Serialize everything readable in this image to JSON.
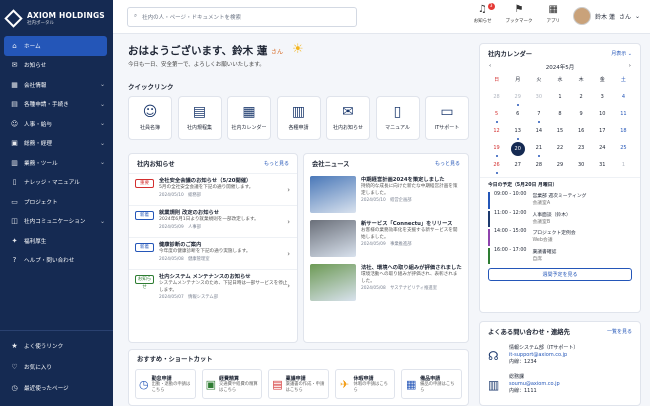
{
  "brand": {
    "name": "AXIOM HOLDINGS",
    "sub": "社内ポータル"
  },
  "sidebar": {
    "items": [
      {
        "label": "ホーム",
        "icon": "home-icon",
        "glyph": "⌂",
        "active": true
      },
      {
        "label": "お知らせ",
        "icon": "megaphone-icon",
        "glyph": "✉"
      },
      {
        "label": "会社情報",
        "icon": "building-icon",
        "glyph": "▦",
        "chev": true
      },
      {
        "label": "各種申請・手続き",
        "icon": "document-icon",
        "glyph": "▤",
        "chev": true
      },
      {
        "label": "人事・給与",
        "icon": "person-icon",
        "glyph": "☺",
        "chev": true
      },
      {
        "label": "総務・経理",
        "icon": "calculator-icon",
        "glyph": "▣",
        "chev": true
      },
      {
        "label": "業務・ツール",
        "icon": "briefcase-icon",
        "glyph": "▥",
        "chev": true
      },
      {
        "label": "ナレッジ・マニュアル",
        "icon": "book-icon",
        "glyph": "▯"
      },
      {
        "label": "プロジェクト",
        "icon": "folder-icon",
        "glyph": "▭"
      },
      {
        "label": "社内コミュニケーション",
        "icon": "chat-icon",
        "glyph": "◫",
        "chev": true
      },
      {
        "label": "福利厚生",
        "icon": "gift-icon",
        "glyph": "✦"
      },
      {
        "label": "ヘルプ・問い合わせ",
        "icon": "help-icon",
        "glyph": "?"
      }
    ],
    "bottom": [
      {
        "label": "よく使うリンク",
        "icon": "star-icon",
        "glyph": "★"
      },
      {
        "label": "お気に入り",
        "icon": "heart-icon",
        "glyph": "♡"
      },
      {
        "label": "最近使ったページ",
        "icon": "clock-icon",
        "glyph": "◷"
      }
    ]
  },
  "search": {
    "placeholder": "社内の人・ページ・ドキュメントを検索"
  },
  "topbar": {
    "notify": "お知らせ",
    "notify_count": "3",
    "bookmark": "ブックマーク",
    "apps": "アプリ",
    "user": "鈴木 蓮",
    "honorific": "さん"
  },
  "greeting": {
    "text": "おはようございます、鈴木 蓮",
    "suffix": "さん",
    "sub": "今日も一日、安全第一で、よろしくお願いいたします。"
  },
  "quick": {
    "title": "クイックリンク",
    "items": [
      {
        "label": "社員名簿",
        "glyph": "☺",
        "icon": "people-icon"
      },
      {
        "label": "社内規程集",
        "glyph": "▤",
        "icon": "document-icon"
      },
      {
        "label": "社内カレンダー",
        "glyph": "▦",
        "icon": "calendar-icon"
      },
      {
        "label": "各種申請",
        "glyph": "▥",
        "icon": "form-icon"
      },
      {
        "label": "社内お知らせ",
        "glyph": "✉",
        "icon": "megaphone-icon"
      },
      {
        "label": "マニュアル",
        "glyph": "▯",
        "icon": "book-icon"
      },
      {
        "label": "ITサポート",
        "glyph": "▭",
        "icon": "monitor-icon"
      }
    ]
  },
  "notices": {
    "title": "社内お知らせ",
    "more": "もっと見る",
    "items": [
      {
        "tag": "重要",
        "color": "#d32f2f",
        "title": "全社安全会議のお知らせ（5/20開催）",
        "desc": "5月の全社安全会議を下記の通り開催します。",
        "date": "2024/05/10",
        "dept": "総務部"
      },
      {
        "tag": "新着",
        "color": "#2456b8",
        "title": "就業規則 改定のお知らせ",
        "desc": "2024年6月1日より就業規則を一部改定します。",
        "date": "2024/05/09",
        "dept": "人事部"
      },
      {
        "tag": "新着",
        "color": "#2456b8",
        "title": "健康診断のご案内",
        "desc": "今年度の健康診断を下記の通り実施します。",
        "date": "2024/05/08",
        "dept": "健康管理室"
      },
      {
        "tag": "お知らせ",
        "color": "#2e7d32",
        "title": "社内システム メンテナンスのお知らせ",
        "desc": "システムメンテナンスのため、下記日時は一部サービスを停止します。",
        "date": "2024/05/07",
        "dept": "情報システム部"
      }
    ]
  },
  "news": {
    "title": "会社ニュース",
    "more": "もっと見る",
    "items": [
      {
        "title": "中期経営計画2024を策定しました",
        "desc": "持続的な成長に向けた新たな中期経営計画を策定しました。",
        "date": "2024/05/10",
        "dept": "経営企画部",
        "color": "#4a78b8"
      },
      {
        "title": "新サービス「Connectu」をリリース",
        "desc": "お客様の業務効率化を支援する新サービスを開始しました。",
        "date": "2024/05/09",
        "dept": "事業推進部",
        "color": "#6a6f79"
      },
      {
        "title": "法社、環境への取り組みが評価されました",
        "desc": "環境活動への取り組みが評価され、表彰されました。",
        "date": "2024/05/08",
        "dept": "サステナビリティ推進室",
        "color": "#6d9a55"
      }
    ]
  },
  "calendar": {
    "title": "社内カレンダー",
    "view": "月表示",
    "month": "2024年5月",
    "weekdays": [
      "日",
      "月",
      "火",
      "水",
      "木",
      "金",
      "土"
    ],
    "days": [
      "28",
      "29",
      "30",
      "1",
      "2",
      "3",
      "4",
      "5",
      "6",
      "7",
      "8",
      "9",
      "10",
      "11",
      "12",
      "13",
      "14",
      "15",
      "16",
      "17",
      "18",
      "19",
      "20",
      "21",
      "22",
      "23",
      "24",
      "25",
      "26",
      "27",
      "28",
      "29",
      "30",
      "31",
      "1"
    ],
    "today": "20"
  },
  "schedule": {
    "title": "今日の予定（5月20日 月曜日）",
    "items": [
      {
        "time": "09:00 - 10:00",
        "title": "営業部 週次ミーティング",
        "place": "会議室A",
        "color": "#2456b8"
      },
      {
        "time": "11:00 - 12:00",
        "title": "人事面談（鈴木）",
        "place": "会議室B",
        "color": "#1d3a6e"
      },
      {
        "time": "14:00 - 15:00",
        "title": "プロジェクト定例会",
        "place": "Web会議",
        "color": "#8e44ad"
      },
      {
        "time": "16:00 - 17:00",
        "title": "稟議書確認",
        "place": "自席",
        "color": "#2e7d32"
      }
    ],
    "button": "週間予定を見る"
  },
  "shortcuts": {
    "title": "おすすめ・ショートカット",
    "items": [
      {
        "title": "勤怠申請",
        "desc": "出勤・退勤の申請はこちら",
        "glyph": "◷",
        "icon": "clock-icon",
        "color": "#2456b8"
      },
      {
        "title": "経費精算",
        "desc": "交通費や経費の精算はこちら",
        "glyph": "▣",
        "icon": "receipt-icon",
        "color": "#2e7d32"
      },
      {
        "title": "稟議申請",
        "desc": "稟議書の作成・申請はこちら",
        "glyph": "▤",
        "icon": "approval-icon",
        "color": "#d32f2f"
      },
      {
        "title": "休暇申請",
        "desc": "休暇の申請はこちら",
        "glyph": "✈",
        "icon": "plane-icon",
        "color": "#f39c12"
      },
      {
        "title": "備品申請",
        "desc": "備品の申請はこちら",
        "glyph": "▦",
        "icon": "box-icon",
        "color": "#2456b8"
      }
    ]
  },
  "contacts": {
    "title": "よくある問い合わせ・連絡先",
    "more": "一覧を見る",
    "items": [
      {
        "dept": "情報システム部（ITサポート）",
        "mail": "it-support@axiom.co.jp",
        "tel": "内線：1234",
        "glyph": "☊",
        "icon": "headset-icon"
      },
      {
        "dept": "総務課",
        "mail": "soumu@axiom.co.jp",
        "tel": "内線：1111",
        "glyph": "▥",
        "icon": "building-icon"
      }
    ]
  }
}
